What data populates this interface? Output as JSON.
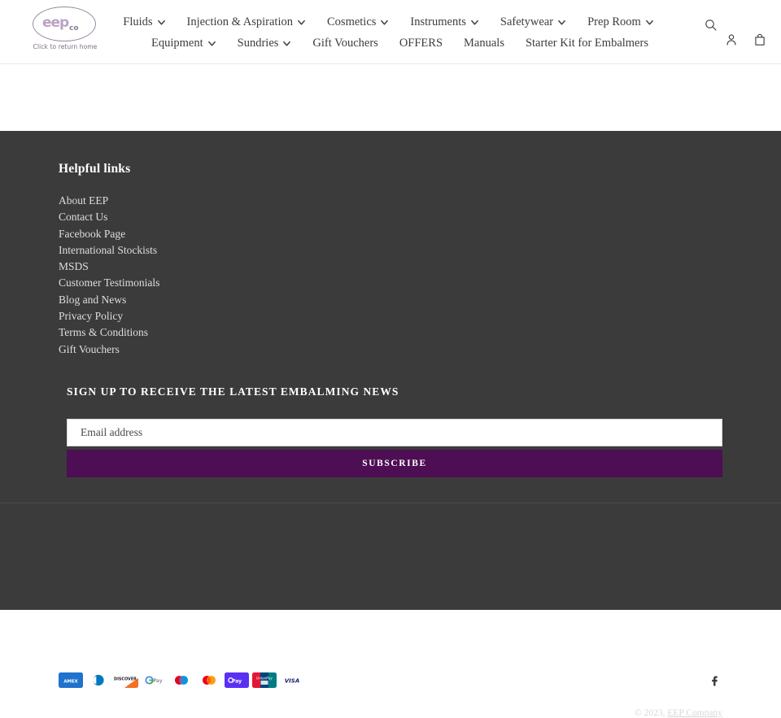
{
  "header": {
    "logo": {
      "mark_primary": "eep",
      "mark_secondary": "co",
      "caption": "Click to return home",
      "icon": "logo-oval-icon"
    },
    "nav_row_1": [
      {
        "label": "Fluids",
        "has_dropdown": true
      },
      {
        "label": "Injection & Aspiration",
        "has_dropdown": true
      },
      {
        "label": "Cosmetics",
        "has_dropdown": true
      },
      {
        "label": "Instruments",
        "has_dropdown": true
      },
      {
        "label": "Safetywear",
        "has_dropdown": true
      },
      {
        "label": "Prep Room",
        "has_dropdown": true
      }
    ],
    "nav_row_2": [
      {
        "label": "Equipment",
        "has_dropdown": true
      },
      {
        "label": "Sundries",
        "has_dropdown": true
      },
      {
        "label": "Gift Vouchers",
        "has_dropdown": false
      },
      {
        "label": "OFFERS",
        "has_dropdown": false
      },
      {
        "label": "Manuals",
        "has_dropdown": false
      },
      {
        "label": "Starter Kit for Embalmers",
        "has_dropdown": false
      }
    ],
    "icons": {
      "search": "search-icon",
      "account": "account-icon",
      "cart": "cart-icon"
    }
  },
  "footer": {
    "heading": "Helpful links",
    "links": [
      "About EEP",
      "Contact Us",
      "Facebook Page",
      "International Stockists",
      "MSDS",
      "Customer Testimonials",
      "Blog and News",
      "Privacy Policy",
      "Terms & Conditions",
      "Gift Vouchers"
    ],
    "newsletter": {
      "title": "SIGN UP TO RECEIVE THE LATEST EMBALMING NEWS",
      "placeholder": "Email address",
      "value": "",
      "button_label": "SUBSCRIBE"
    },
    "payment_methods": [
      "American Express",
      "Diners Club",
      "Discover",
      "Google Pay",
      "Maestro",
      "Mastercard",
      "Shop Pay",
      "Union Pay",
      "Visa"
    ],
    "social": [
      {
        "name": "Facebook",
        "icon": "facebook-icon",
        "glyph": "f"
      }
    ],
    "copyright_prefix": "© 2023, ",
    "copyright_link": "EEP Company"
  },
  "colors": {
    "footer_bg": "#3b3b3b",
    "accent_purple": "#4e0e54",
    "logo_mauve": "#b9a3c2",
    "text_dark": "#3d3d3d"
  }
}
